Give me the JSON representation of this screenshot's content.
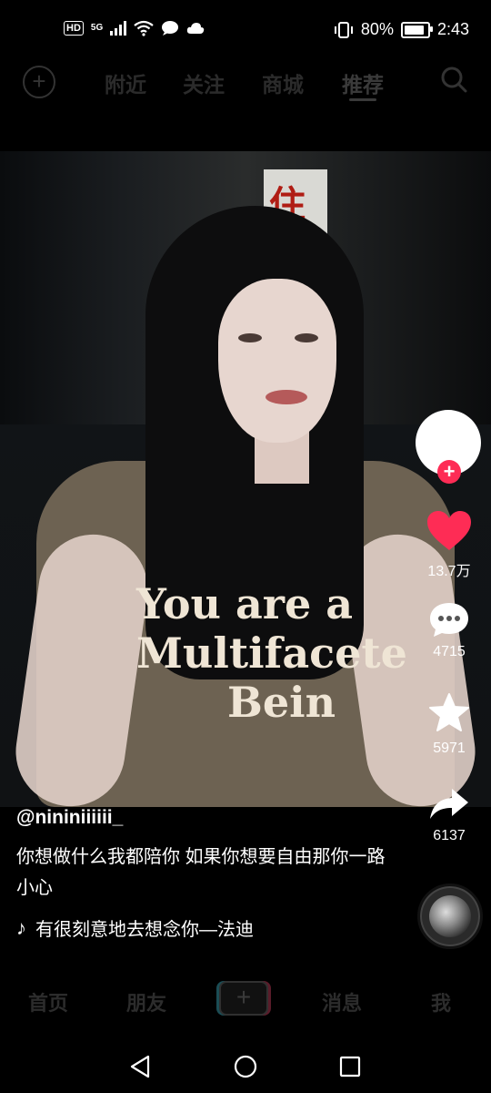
{
  "status_bar": {
    "left_badges": [
      "HD",
      "5G"
    ],
    "battery": "80%",
    "time": "2:43"
  },
  "top_nav": {
    "tabs": [
      "附近",
      "关注",
      "商城",
      "推荐"
    ],
    "active_tab": "推荐"
  },
  "photo": {
    "shirt_text_line1": "You are a",
    "shirt_text_line2": "Multifacete",
    "shirt_text_line3": "Bein",
    "sign_char": "住"
  },
  "rail": {
    "likes": "13.7万",
    "comments": "4715",
    "favorites": "5971",
    "shares": "6137"
  },
  "post": {
    "author": "@nininiiiiii_",
    "caption": "你想做什么我都陪你 如果你想要自由那你一路小心",
    "music": "有很刻意地去想念你—法迪"
  },
  "bottom_nav": {
    "home": "首页",
    "friends": "朋友",
    "create": "+",
    "messages": "消息",
    "me": "我"
  },
  "colors": {
    "like_red": "#fe2c55",
    "background": "#000000"
  }
}
